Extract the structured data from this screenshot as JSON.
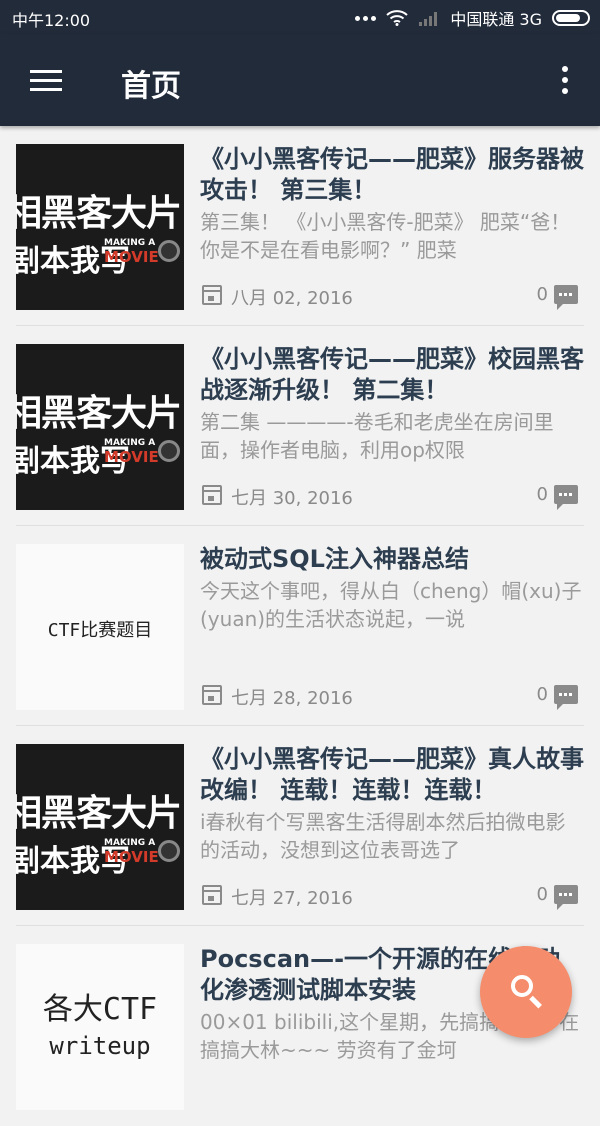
{
  "status_bar": {
    "time": "中午12:00",
    "carrier": "中国联通 3G"
  },
  "app_bar": {
    "title": "首页"
  },
  "thumbs": {
    "game_line1": "相黑客大片",
    "game_line2": "剧本我写",
    "making": "MAKING A",
    "movie": "MOVIE",
    "ctf1": "CTF比赛题目",
    "ctf2_line1": "各大CTF",
    "ctf2_line2": "writeup"
  },
  "articles": [
    {
      "title": "《小小黑客传记——肥菜》服务器被攻击！ 第三集！",
      "excerpt": "第三集！ 《小小黑客传-肥菜》 肥菜“爸！你是不是在看电影啊？” 肥菜",
      "date": "八月 02, 2016",
      "comments": "0"
    },
    {
      "title": "《小小黑客传记——肥菜》校园黑客战逐渐升级！ 第二集！",
      "excerpt": "第二集 ————-卷毛和老虎坐在房间里面，操作者电脑，利用op权限",
      "date": "七月 30, 2016",
      "comments": "0"
    },
    {
      "title": "被动式SQL注入神器总结",
      "excerpt": "今天这个事吧，得从白（cheng）帽(xu)子(yuan)的生活状态说起，一说",
      "date": "七月 28, 2016",
      "comments": "0"
    },
    {
      "title": "《小小黑客传记——肥菜》真人故事改编！ 连载！连载！连载！",
      "excerpt": "i春秋有个写黑客生活得剧本然后拍微电影的活动，没想到这位表哥选了",
      "date": "七月 27, 2016",
      "comments": "0"
    },
    {
      "title": "Pocscan—-一个开源的在线自动化渗透测试脚本安装",
      "excerpt": "00×01 bilibili,这个星期，先搞搞福利，在搞搞大林~~~ 劳资有了金坷",
      "date": "",
      "comments": ""
    }
  ]
}
